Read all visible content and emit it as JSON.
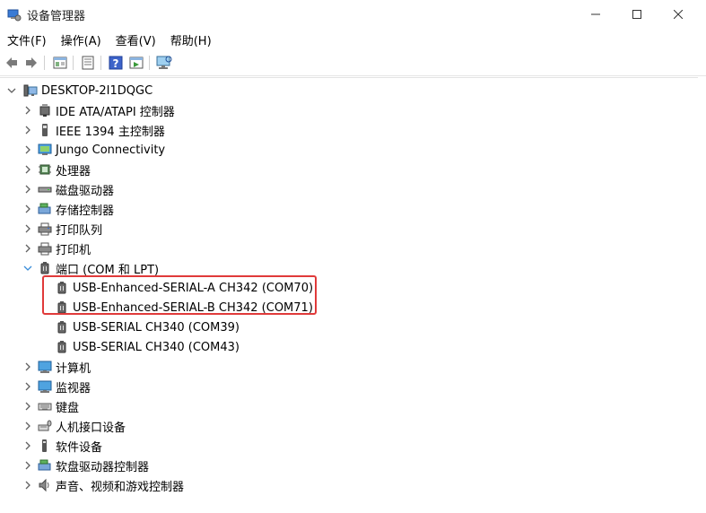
{
  "window": {
    "title": "设备管理器"
  },
  "menu": [
    "文件(F)",
    "操作(A)",
    "查看(V)",
    "帮助(H)"
  ],
  "toolbar": {
    "buttons": [
      "back-arrow-icon",
      "forward-arrow-icon",
      "properties-icon",
      "update-driver-icon",
      "help-icon",
      "run-icon",
      "monitor-scan-icon"
    ]
  },
  "tree": {
    "root": "DESKTOP-2I1DQGC",
    "items": [
      {
        "label": "IDE ATA/ATAPI 控制器",
        "icon": "ide-controller-icon",
        "expanded": false
      },
      {
        "label": "IEEE 1394 主控制器",
        "icon": "ieee1394-icon",
        "expanded": false
      },
      {
        "label": "Jungo Connectivity",
        "icon": "jungo-icon",
        "expanded": false
      },
      {
        "label": "处理器",
        "icon": "processor-icon",
        "expanded": false
      },
      {
        "label": "磁盘驱动器",
        "icon": "disk-drive-icon",
        "expanded": false
      },
      {
        "label": "存储控制器",
        "icon": "storage-controller-icon",
        "expanded": false
      },
      {
        "label": "打印队列",
        "icon": "print-queue-icon",
        "expanded": false
      },
      {
        "label": "打印机",
        "icon": "printer-icon",
        "expanded": false
      },
      {
        "label": "端口 (COM 和 LPT)",
        "icon": "port-icon",
        "expanded": true
      },
      {
        "label": "计算机",
        "icon": "computer-icon",
        "expanded": false
      },
      {
        "label": "监视器",
        "icon": "monitor-icon",
        "expanded": false
      },
      {
        "label": "键盘",
        "icon": "keyboard-icon",
        "expanded": false
      },
      {
        "label": "人机接口设备",
        "icon": "hid-icon",
        "expanded": false
      },
      {
        "label": "软件设备",
        "icon": "software-device-icon",
        "expanded": false
      },
      {
        "label": "软盘驱动器控制器",
        "icon": "floppy-controller-icon",
        "expanded": false
      },
      {
        "label": "声音、视频和游戏控制器",
        "icon": "sound-icon",
        "expanded": false
      }
    ],
    "ports": [
      "USB-Enhanced-SERIAL-A CH342 (COM70)",
      "USB-Enhanced-SERIAL-B CH342 (COM71)",
      "USB-SERIAL CH340 (COM39)",
      "USB-SERIAL CH340 (COM43)"
    ]
  },
  "colors": {
    "highlight_border": "#e03a3a",
    "chevron": "#606060",
    "scrollbar_thumb": "#c1c1c1"
  }
}
